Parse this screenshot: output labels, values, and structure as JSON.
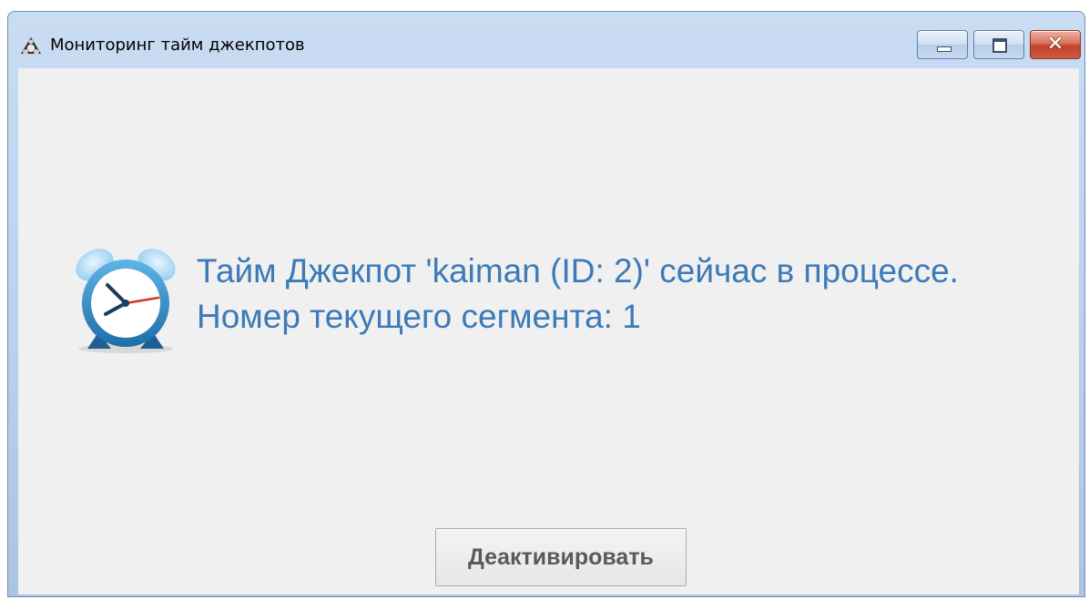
{
  "window": {
    "title": "Мониторинг тайм джекпотов",
    "close_glyph": "✕"
  },
  "main": {
    "message_line1": "Тайм Джекпот 'kaiman (ID: 2)' сейчас в процессе.",
    "message_line2": "Номер текущего сегмента: 1",
    "deactivate_label": "Деактивировать",
    "icon": "alarm-clock-icon",
    "text_color": "#3c7ab8"
  }
}
